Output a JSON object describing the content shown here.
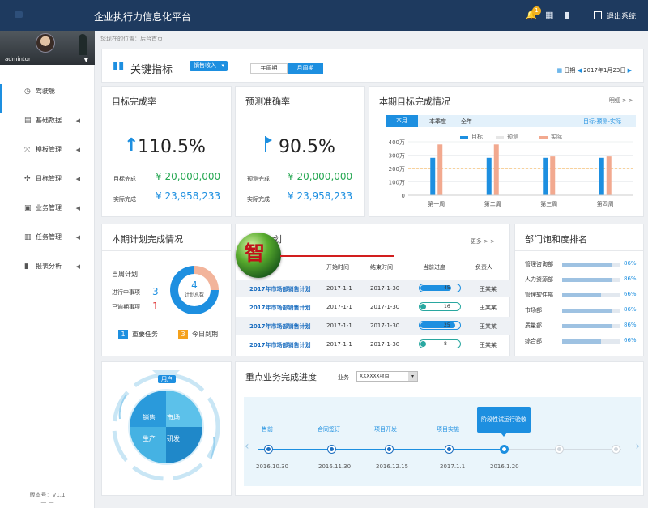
{
  "header": {
    "title": "企业执行力信息化平台",
    "notification_count": "1",
    "logout_label": "退出系统"
  },
  "sidebar": {
    "username": "admintor",
    "items": [
      {
        "label": "驾驶舱",
        "icon": "dashboard-icon"
      },
      {
        "label": "基础数据",
        "icon": "database-icon"
      },
      {
        "label": "模板管理",
        "icon": "template-icon"
      },
      {
        "label": "目标管理",
        "icon": "target-icon"
      },
      {
        "label": "业务管理",
        "icon": "business-icon"
      },
      {
        "label": "任务管理",
        "icon": "task-icon"
      },
      {
        "label": "报表分析",
        "icon": "report-icon"
      }
    ],
    "version_label": "版本号：V1.1",
    "version_sub": "·—·—·"
  },
  "breadcrumb": "您现在的位置：后台首页",
  "kpi_header": {
    "title": "关键指标",
    "select_value": "销售收入",
    "toggle_year": "年周期",
    "toggle_month": "月周期",
    "date_label": "日期",
    "date_value": "2017年1月23日"
  },
  "target_rate": {
    "title": "目标完成率",
    "value": "110.5%",
    "target_label": "目标完成",
    "target_value": "¥ 20,000,000",
    "actual_label": "实际完成",
    "actual_value": "¥ 23,958,233"
  },
  "forecast_rate": {
    "title": "预测准确率",
    "value": "90.5%",
    "forecast_label": "预测完成",
    "forecast_value": "¥ 20,000,000",
    "actual_label": "实际完成",
    "actual_value": "¥ 23,958,233"
  },
  "goal_chart": {
    "title": "本期目标完成情况",
    "detail_link": "明细 > >",
    "tabs": [
      "本月",
      "本季度",
      "全年"
    ],
    "tab_right": "目标-预测-实际"
  },
  "chart_data": {
    "type": "bar",
    "categories": [
      "第一周",
      "第二周",
      "第三周",
      "第四周"
    ],
    "series": [
      {
        "name": "目标",
        "values": [
          280,
          280,
          280,
          280
        ]
      },
      {
        "name": "预测",
        "values": [
          0,
          0,
          0,
          0
        ]
      },
      {
        "name": "实际",
        "values": [
          380,
          380,
          290,
          290
        ]
      }
    ],
    "yticks": [
      "0",
      "100万",
      "200万",
      "300万",
      "400万"
    ],
    "reference_line": 200,
    "ylim": [
      0,
      400
    ],
    "colors": {
      "目标": "#1d8fe0",
      "预测": "#e6e6e6",
      "实际": "#f2a98f"
    }
  },
  "plan_card": {
    "title": "本期计划完成情况",
    "week_label": "当周计划",
    "in_progress_label": "进行中事项",
    "in_progress_value": "3",
    "overdue_label": "已逾期事项",
    "overdue_value": "1",
    "donut_center_value": "4",
    "donut_center_label": "计划总数",
    "tag_important_num": "1",
    "tag_important_label": "重要任务",
    "tag_today_num": "3",
    "tag_today_label": "今日到期"
  },
  "plan_table": {
    "title_fragment": "划",
    "more_link": "更多 > >",
    "headers": [
      "开始时间",
      "结束时间",
      "当前进度",
      "负责人"
    ],
    "rows": [
      {
        "name": "2017年市场部销售计划",
        "start": "2017-1-1",
        "end": "2017-1-30",
        "progress": "45",
        "owner": "王某某"
      },
      {
        "name": "2017年市场部销售计划",
        "start": "2017-1-1",
        "end": "2017-1-30",
        "progress": "16",
        "owner": "王某某"
      },
      {
        "name": "2017年市场部销售计划",
        "start": "2017-1-1",
        "end": "2017-1-30",
        "progress": "25",
        "owner": "王某某"
      },
      {
        "name": "2017年市场部销售计划",
        "start": "2017-1-1",
        "end": "2017-1-30",
        "progress": "8",
        "owner": "王某某"
      }
    ],
    "progress_fraction": [
      0.8,
      0.0,
      0.9,
      0.0
    ],
    "logo_text": "智"
  },
  "ranking": {
    "title": "部门饱和度排名",
    "rows": [
      {
        "dept": "管理咨询部",
        "pct": "86%",
        "value": 86
      },
      {
        "dept": "人力资源部",
        "pct": "86%",
        "value": 86
      },
      {
        "dept": "管理软件部",
        "pct": "66%",
        "value": 66
      },
      {
        "dept": "市场部",
        "pct": "86%",
        "value": 86
      },
      {
        "dept": "质量部",
        "pct": "86%",
        "value": 86
      },
      {
        "dept": "综合部",
        "pct": "66%",
        "value": 66
      }
    ]
  },
  "user_wheel": {
    "user_label": "用户",
    "quadrants": [
      "销售",
      "市场",
      "生产",
      "研发"
    ]
  },
  "progress_card": {
    "title": "重点业务完成进度",
    "filter_label": "业务",
    "filter_value": "XXXXXX项目",
    "stages": [
      {
        "label": "售前",
        "date": "2016.10.30",
        "state": "done"
      },
      {
        "label": "合同签订",
        "date": "2016.11.30",
        "state": "done"
      },
      {
        "label": "项目开发",
        "date": "2016.12.15",
        "state": "done"
      },
      {
        "label": "项目实施",
        "date": "2017.1.1",
        "state": "done"
      },
      {
        "label": "阶段性试运行验收",
        "date": "2016.1.20",
        "state": "current"
      }
    ]
  }
}
